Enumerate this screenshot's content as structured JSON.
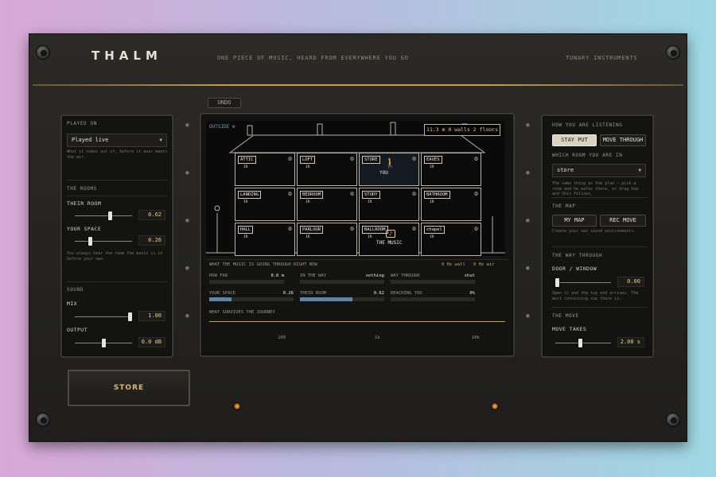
{
  "header": {
    "logo": "THALM",
    "tagline": "ONE PIECE OF MUSIC, HEARD FROM EVERYWHERE YOU GO",
    "brand": "TUNARY INSTRUMENTS"
  },
  "toolbar": {
    "undo_label": "UNDO"
  },
  "left": {
    "played_on_title": "PLAYED ON",
    "played_on_value": "Played live",
    "played_on_note": "What it comes out of, before it ever meets the air.",
    "rooms_title": "THE ROOMS",
    "their_room_label": "THEIR ROOM",
    "their_room_value": "0.62",
    "their_room_level": 0.62,
    "your_space_label": "YOUR SPACE",
    "your_space_value": "0.26",
    "your_space_level": 0.26,
    "rooms_note": "You always hear the room the music is in before your own.",
    "sound_title": "SOUND",
    "mix_label": "MIX",
    "mix_value": "1.00",
    "mix_level": 1.0,
    "output_label": "OUTPUT",
    "output_value": "0.0 dB",
    "output_level": 0.5
  },
  "store_label": "STORE",
  "center": {
    "outside_label": "OUTSIDE",
    "stats": "11.3 m   0 walls   2 floors",
    "rooms": [
      {
        "name": "ATTIC",
        "ir": "IR"
      },
      {
        "name": "LOFT",
        "ir": "IR"
      },
      {
        "name": "STORE",
        "ir": ""
      },
      {
        "name": "EAVES",
        "ir": "IR"
      },
      {
        "name": "LANDING",
        "ir": "IR"
      },
      {
        "name": "BEDROOM",
        "ir": "IR"
      },
      {
        "name": "STUDY",
        "ir": "IR"
      },
      {
        "name": "BATHROOM",
        "ir": "IR"
      },
      {
        "name": "HALL",
        "ir": "IR"
      },
      {
        "name": "PARLOUR",
        "ir": "IR"
      },
      {
        "name": "BALLROOM",
        "ir": "IR"
      },
      {
        "name": "chapel",
        "ir": "IR"
      }
    ],
    "you_label": "YOU",
    "music_label": "THE MUSIC",
    "metrics_title": "WHAT THE MUSIC IS GOING THROUGH RIGHT NOW",
    "metrics_right_1": "0 Hz wall",
    "metrics_right_2": "0 Hz air",
    "how_far_label": "HOW FAR",
    "how_far_value": "0.0 m",
    "in_the_way_label": "IN THE WAY",
    "in_the_way_value": "nothing",
    "way_through_label": "WAY THROUGH",
    "way_through_value": "shut",
    "your_space_label": "YOUR SPACE",
    "your_space_value": "0.26",
    "your_space_level": 0.26,
    "their_room_label": "THEIR ROOM",
    "their_room_value": "0.62",
    "their_room_level": 0.62,
    "reaching_label": "REACHING YOU",
    "reaching_value": "0%",
    "reaching_level": 0,
    "survives_title": "WHAT SURVIVES THE JOURNEY",
    "freq_labels": [
      "100",
      "1k",
      "10k"
    ]
  },
  "right": {
    "listening_title": "HOW YOU ARE LISTENING",
    "stay_put": "STAY PUT",
    "move_through": "MOVE THROUGH",
    "which_room_title": "WHICH ROOM YOU ARE IN",
    "room_value": "store",
    "room_note": "The same thing as the plan — pick a room and he walks there, or drag him and this follows.",
    "map_title": "THE MAP",
    "my_map": "MY MAP",
    "rec_move": "REC MOVE",
    "map_note": "Create your own sound environments.",
    "way_through_title": "THE WAY THROUGH",
    "door_label": "DOOR / WINDOW",
    "door_value": "0.00",
    "door_level": 0,
    "door_note": "Open it and the top end arrives. The most convincing cue there is.",
    "move_title": "THE MOVE",
    "move_takes_label": "MOVE TAKES",
    "move_takes_value": "2.00 s",
    "move_level": 0.45
  }
}
